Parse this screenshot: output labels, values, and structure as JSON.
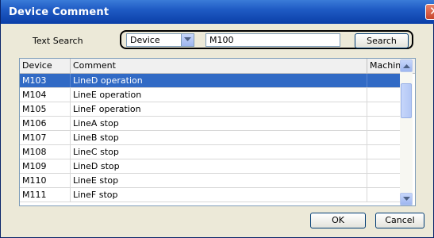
{
  "window": {
    "title": "Device Comment",
    "close_glyph": "✕"
  },
  "search": {
    "label": "Text Search",
    "field_selected": "Device",
    "query": "M100",
    "button_label": "Search"
  },
  "table": {
    "columns": [
      "Device",
      "Comment",
      "Machines"
    ],
    "selected_index": 0,
    "rows": [
      {
        "device": "M103",
        "comment": "LineD operation",
        "machines": ""
      },
      {
        "device": "M104",
        "comment": "LineE operation",
        "machines": ""
      },
      {
        "device": "M105",
        "comment": "LineF operation",
        "machines": ""
      },
      {
        "device": "M106",
        "comment": "LineA stop",
        "machines": ""
      },
      {
        "device": "M107",
        "comment": "LineB stop",
        "machines": ""
      },
      {
        "device": "M108",
        "comment": "LineC stop",
        "machines": ""
      },
      {
        "device": "M109",
        "comment": "LineD stop",
        "machines": ""
      },
      {
        "device": "M110",
        "comment": "LineE stop",
        "machines": ""
      },
      {
        "device": "M111",
        "comment": "LineF stop",
        "machines": ""
      }
    ]
  },
  "buttons": {
    "ok": "OK",
    "cancel": "Cancel"
  },
  "colors": {
    "titlebar": "#0b3fa8",
    "selection": "#316ac5",
    "window_bg": "#ece9d8"
  }
}
